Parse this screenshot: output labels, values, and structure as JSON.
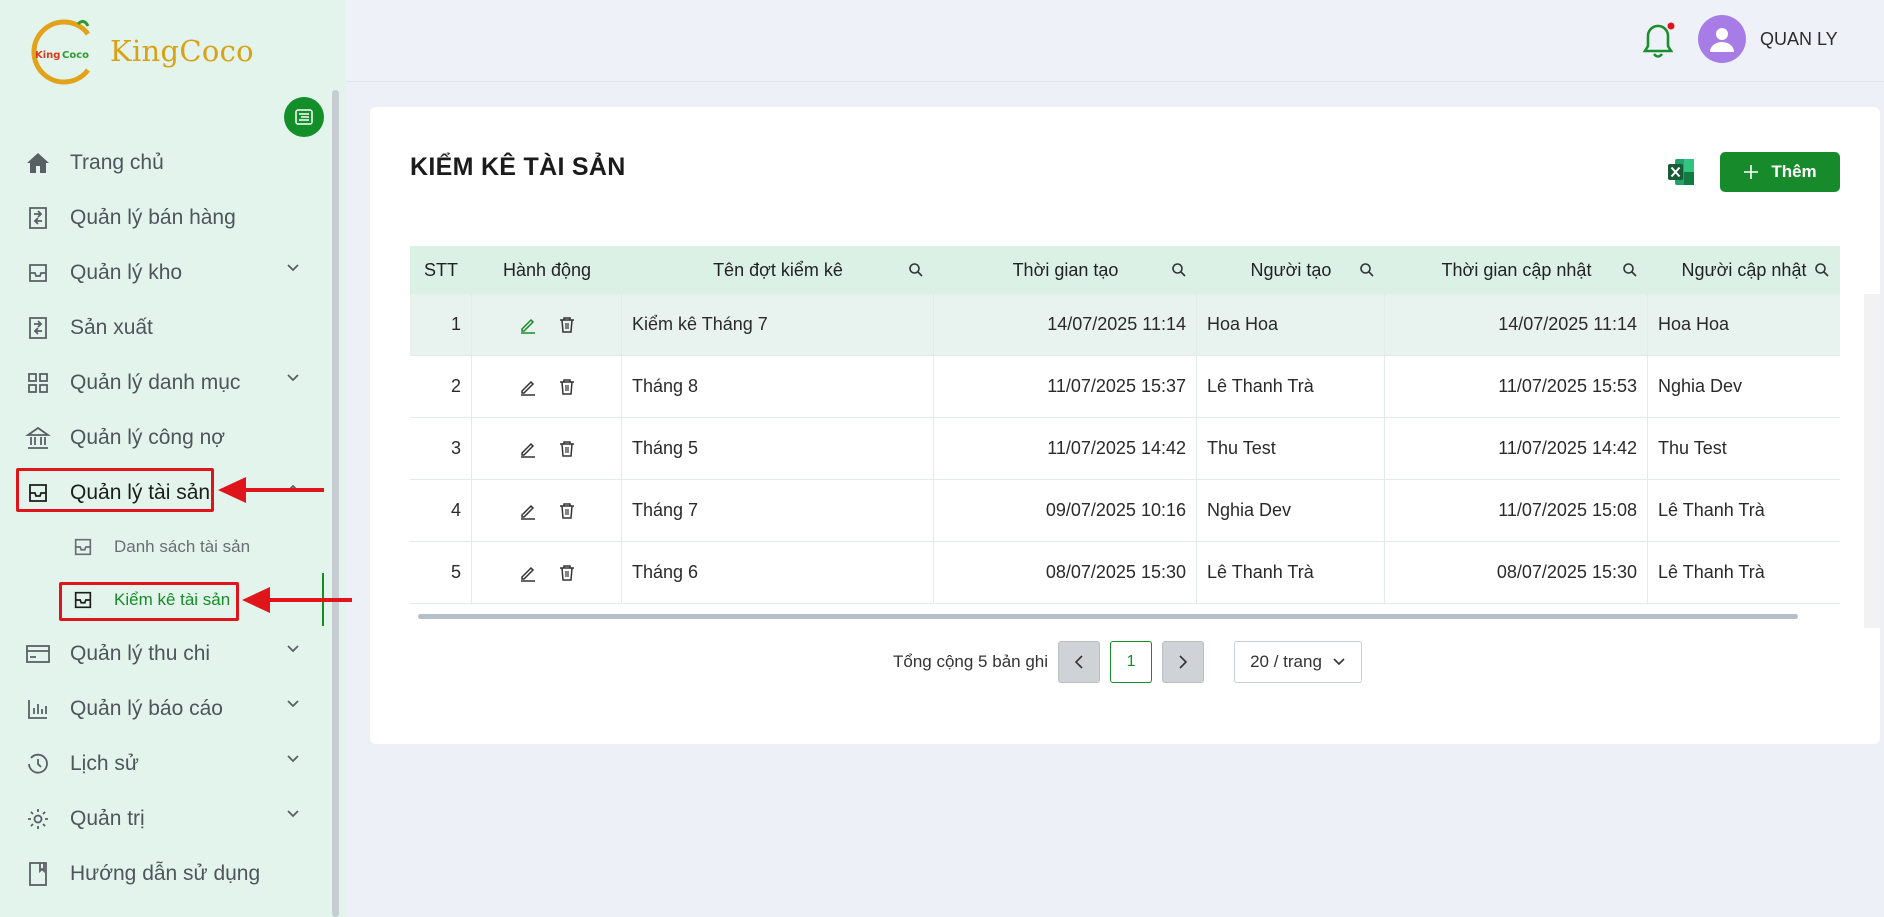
{
  "brand": {
    "name": "KingCoco",
    "logo_text": "KingCoco"
  },
  "sidebar": {
    "items": [
      {
        "label": "Trang chủ",
        "icon": "home-icon",
        "has_chevron": false
      },
      {
        "label": "Quản lý bán hàng",
        "icon": "sales-icon",
        "has_chevron": false
      },
      {
        "label": "Quản lý kho",
        "icon": "inbox-icon",
        "has_chevron": true
      },
      {
        "label": "Sản xuất",
        "icon": "production-icon",
        "has_chevron": false
      },
      {
        "label": "Quản lý danh mục",
        "icon": "grid-icon",
        "has_chevron": true
      },
      {
        "label": "Quản lý công nợ",
        "icon": "bank-icon",
        "has_chevron": false
      },
      {
        "label": "Quản lý tài sản",
        "icon": "inbox-icon",
        "has_chevron": true,
        "expanded": true
      },
      {
        "label": "Quản lý thu chi",
        "icon": "card-icon",
        "has_chevron": true
      },
      {
        "label": "Quản lý báo cáo",
        "icon": "bar-chart-icon",
        "has_chevron": true
      },
      {
        "label": "Lịch sử",
        "icon": "history-icon",
        "has_chevron": true
      },
      {
        "label": "Quản trị",
        "icon": "gear-icon",
        "has_chevron": true
      },
      {
        "label": "Hướng dẫn sử dụng",
        "icon": "book-icon",
        "has_chevron": false
      }
    ],
    "subitems": [
      {
        "label": "Danh sách tài sản",
        "icon": "inbox-icon"
      },
      {
        "label": "Kiểm kê tài sản",
        "icon": "inbox-icon",
        "active": true
      }
    ]
  },
  "header": {
    "user_name": "QUAN LY",
    "notification_dot": true
  },
  "page": {
    "title": "KIỂM KÊ TÀI SẢN",
    "add_label": "Thêm",
    "columns": [
      "STT",
      "Hành động",
      "Tên đợt kiểm kê",
      "Thời gian tạo",
      "Người tạo",
      "Thời gian cập nhật",
      "Người cập nhật"
    ],
    "rows": [
      {
        "stt": "1",
        "name": "Kiểm kê Tháng 7",
        "created": "14/07/2025 11:14",
        "creator": "Hoa Hoa",
        "updated": "14/07/2025 11:14",
        "updater": "Hoa Hoa"
      },
      {
        "stt": "2",
        "name": "Tháng 8",
        "created": "11/07/2025 15:37",
        "creator": "Lê Thanh Trà",
        "updated": "11/07/2025 15:53",
        "updater": "Nghia Dev"
      },
      {
        "stt": "3",
        "name": "Tháng 5",
        "created": "11/07/2025 14:42",
        "creator": "Thu Test",
        "updated": "11/07/2025 14:42",
        "updater": "Thu Test"
      },
      {
        "stt": "4",
        "name": "Tháng 7",
        "created": "09/07/2025 10:16",
        "creator": "Nghia Dev",
        "updated": "11/07/2025 15:08",
        "updater": "Lê Thanh Trà"
      },
      {
        "stt": "5",
        "name": "Tháng 6",
        "created": "08/07/2025 15:30",
        "creator": "Lê Thanh Trà",
        "updated": "08/07/2025 15:30",
        "updater": "Lê Thanh Trà"
      }
    ],
    "pagination": {
      "total_label": "Tổng cộng 5 bản ghi",
      "current_page": "1",
      "page_size": "20 / trang"
    }
  },
  "colors": {
    "accent": "#168c28",
    "highlight": "#e0151b",
    "sidebar_bg": "#e3f4ec",
    "header_row": "#dcf1e6"
  }
}
